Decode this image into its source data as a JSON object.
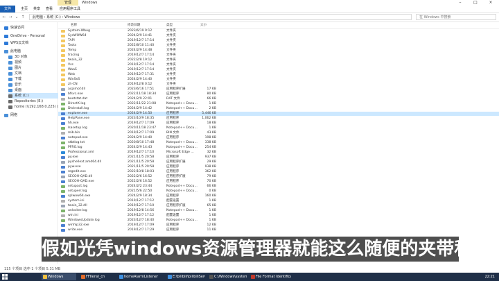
{
  "titlebar": {
    "manage_tab": "管理",
    "window_title": "Windows"
  },
  "ribbon": {
    "tabs": [
      "文件",
      "主页",
      "共享",
      "查看",
      "应用程序工具"
    ]
  },
  "address": {
    "path": "此电脑 › 系统 (C:) › Windows",
    "search_placeholder": "在 Windows 中搜索"
  },
  "nav": {
    "items": [
      {
        "label": "快速访问",
        "color": "#2f7bd8"
      },
      {
        "label": "OneDrive - Personal",
        "color": "#2f7bd8"
      },
      {
        "label": "WPS云文档",
        "color": "#2f7bd8"
      },
      {
        "label": "此电脑",
        "color": "#4a90d9"
      },
      {
        "label": "3D 对象",
        "color": "#4a90d9"
      },
      {
        "label": "视频",
        "color": "#4a90d9"
      },
      {
        "label": "图片",
        "color": "#4a90d9"
      },
      {
        "label": "文档",
        "color": "#4a90d9"
      },
      {
        "label": "下载",
        "color": "#4a90d9"
      },
      {
        "label": "音乐",
        "color": "#4a90d9"
      },
      {
        "label": "桌面",
        "color": "#4a90d9"
      },
      {
        "label": "系统 (C:)",
        "color": "#6b6b6b"
      },
      {
        "label": "Repositories (E:)",
        "color": "#6b6b6b"
      },
      {
        "label": "home (\\\\192.168.0.225) (Z:)",
        "color": "#6b6b6b"
      },
      {
        "label": "网络",
        "color": "#4a90d9"
      }
    ]
  },
  "columns": {
    "name": "名称",
    "date": "修改日期",
    "type": "类型",
    "size": "大小"
  },
  "files": [
    {
      "name": "System-Wbug",
      "date": "2023/6/19 9:12",
      "type": "文件夹",
      "size": "",
      "kind": "folder"
    },
    {
      "name": "SysWOW64",
      "date": "2024/2/9 14:41",
      "type": "文件夹",
      "size": "",
      "kind": "folder"
    },
    {
      "name": "TAPI",
      "date": "2019/12/7 17:14",
      "type": "文件夹",
      "size": "",
      "kind": "folder"
    },
    {
      "name": "Tasks",
      "date": "2022/8/10 11:40",
      "type": "文件夹",
      "size": "",
      "kind": "folder"
    },
    {
      "name": "Temp",
      "date": "2024/2/9 14:48",
      "type": "文件夹",
      "size": "",
      "kind": "folder"
    },
    {
      "name": "tracing",
      "date": "2019/12/7 17:14",
      "type": "文件夹",
      "size": "",
      "kind": "folder"
    },
    {
      "name": "twain_32",
      "date": "2022/2/8 19:12",
      "type": "文件夹",
      "size": "",
      "kind": "folder"
    },
    {
      "name": "Vss",
      "date": "2019/12/7 17:14",
      "type": "文件夹",
      "size": "",
      "kind": "folder"
    },
    {
      "name": "WaaS",
      "date": "2019/12/7 17:14",
      "type": "文件夹",
      "size": "",
      "kind": "folder"
    },
    {
      "name": "Web",
      "date": "2019/12/7 17:31",
      "type": "文件夹",
      "size": "",
      "kind": "folder"
    },
    {
      "name": "WinSxS",
      "date": "2024/2/9 14:40",
      "type": "文件夹",
      "size": "",
      "kind": "folder"
    },
    {
      "name": "zh-CN",
      "date": "2019/12/8 0:12",
      "type": "文件夹",
      "size": "",
      "kind": "folder"
    },
    {
      "name": "acpimof.dll",
      "date": "2023/6/16 17:51",
      "type": "应用程序扩展",
      "size": "17 KB",
      "kind": "dll"
    },
    {
      "name": "bfsvc.exe",
      "date": "2022/11/18 18:34",
      "type": "应用程序",
      "size": "80 KB",
      "kind": "exe"
    },
    {
      "name": "bootstat.dat",
      "date": "2024/2/9 22:01",
      "type": "DAT 文件",
      "size": "66 KB",
      "kind": "dat"
    },
    {
      "name": "DirectX.log",
      "date": "2022/11/22 21:08",
      "type": "Notepad++ Docu...",
      "size": "1 KB",
      "kind": "log"
    },
    {
      "name": "DtcInstall.log",
      "date": "2024/2/9 14:42",
      "type": "Notepad++ Docu...",
      "size": "2 KB",
      "kind": "log"
    },
    {
      "name": "explorer.exe",
      "date": "2024/2/9 14:50",
      "type": "应用程序",
      "size": "5,446 KB",
      "kind": "exe",
      "selected": true
    },
    {
      "name": "HelpPane.exe",
      "date": "2023/10/9 18:35",
      "type": "应用程序",
      "size": "1,062 KB",
      "kind": "exe"
    },
    {
      "name": "hh.exe",
      "date": "2019/12/7 17:09",
      "type": "应用程序",
      "size": "18 KB",
      "kind": "exe"
    },
    {
      "name": "lsasetup.log",
      "date": "2020/11/18 23:47",
      "type": "Notepad++ Docu...",
      "size": "1 KB",
      "kind": "log"
    },
    {
      "name": "mib.bin",
      "date": "2019/12/7 17:09",
      "type": "BIN 文件",
      "size": "43 KB",
      "kind": "dat"
    },
    {
      "name": "notepad.exe",
      "date": "2024/2/9 14:40",
      "type": "应用程序",
      "size": "198 KB",
      "kind": "exe"
    },
    {
      "name": "ntbtlog.txt",
      "date": "2020/8/10 17:48",
      "type": "Notepad++ Docu...",
      "size": "338 KB",
      "kind": "log"
    },
    {
      "name": "PFRO.log",
      "date": "2024/2/9 14:43",
      "type": "Notepad++ Docu...",
      "size": "254 KB",
      "kind": "log"
    },
    {
      "name": "Professional.xml",
      "date": "2019/12/7 17:10",
      "type": "Microsoft Edge ...",
      "size": "32 KB",
      "kind": "xml"
    },
    {
      "name": "py.exe",
      "date": "2021/11/5 20:58",
      "type": "应用程序",
      "size": "937 KB",
      "kind": "exe"
    },
    {
      "name": "pyshellext.amd64.dll",
      "date": "2021/11/5 20:58",
      "type": "应用程序扩展",
      "size": "29 KB",
      "kind": "dll"
    },
    {
      "name": "pyw.exe",
      "date": "2021/11/5 20:58",
      "type": "应用程序",
      "size": "938 KB",
      "kind": "exe"
    },
    {
      "name": "regedit.exe",
      "date": "2022/10/8 18:03",
      "type": "应用程序",
      "size": "362 KB",
      "kind": "exe"
    },
    {
      "name": "SECOH-QAD.dll",
      "date": "2022/2/6 16:52",
      "type": "应用程序扩展",
      "size": "79 KB",
      "kind": "dll"
    },
    {
      "name": "SECOH-QAD.exe",
      "date": "2022/2/6 16:52",
      "type": "应用程序",
      "size": "70 KB",
      "kind": "exe"
    },
    {
      "name": "setupact.log",
      "date": "2024/2/2 23:44",
      "type": "Notepad++ Docu...",
      "size": "66 KB",
      "kind": "log"
    },
    {
      "name": "setuperr.log",
      "date": "2021/5/6 22:50",
      "type": "Notepad++ Docu...",
      "size": "0 KB",
      "kind": "log"
    },
    {
      "name": "splwow64.exe",
      "date": "2024/2/9 18:34",
      "type": "应用程序",
      "size": "160 KB",
      "kind": "exe"
    },
    {
      "name": "system.ini",
      "date": "2019/12/7 17:12",
      "type": "配置设置",
      "size": "1 KB",
      "kind": "dat"
    },
    {
      "name": "twain_32.dll",
      "date": "2019/12/7 17:10",
      "type": "应用程序扩展",
      "size": "65 KB",
      "kind": "dll"
    },
    {
      "name": "unlocker.log",
      "date": "2019/12/8 14:56",
      "type": "Notepad++ Docu...",
      "size": "1 KB",
      "kind": "log"
    },
    {
      "name": "win.ini",
      "date": "2019/12/7 17:12",
      "type": "配置设置",
      "size": "1 KB",
      "kind": "dat"
    },
    {
      "name": "WindowsUpdate.log",
      "date": "2023/12/7 18:40",
      "type": "Notepad++ Docu...",
      "size": "1 KB",
      "kind": "log"
    },
    {
      "name": "winhlp32.exe",
      "date": "2019/12/7 17:09",
      "type": "应用程序",
      "size": "12 KB",
      "kind": "exe"
    },
    {
      "name": "write.exe",
      "date": "2019/12/7 17:29",
      "type": "应用程序",
      "size": "11 KB",
      "kind": "exe"
    }
  ],
  "subtitle": "假如光凭windows资源管理器就能这么随便的夹带私货",
  "status": {
    "text": "115 个项目   选中 1 个项目  5.31 MB"
  },
  "taskbar": {
    "items": [
      {
        "label": "Windows",
        "color": "#f0c040"
      },
      {
        "label": "FFIlensl_cn",
        "color": "#e06b2b"
      },
      {
        "label": "homeAlarmListener",
        "color": "#3d8fe0"
      },
      {
        "label": "E:\\bilibili\\bilibiliServ...",
        "color": "#3d8fe0"
      },
      {
        "label": "C:\\Windows\\system...",
        "color": "#555555"
      },
      {
        "label": "File Format Identifica...",
        "color": "#c0392b"
      }
    ],
    "clock": "22:21"
  },
  "colors": {
    "accent": "#1a5fb4",
    "selection": "#cce8ff",
    "folder": "#f3c75f",
    "taskbar": "#1f2f48"
  }
}
